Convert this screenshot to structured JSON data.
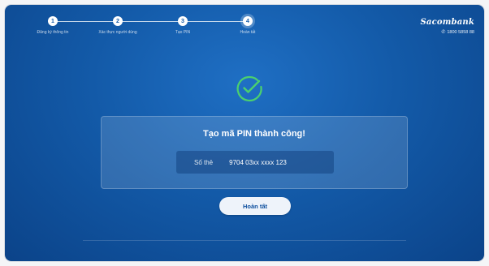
{
  "stepper": {
    "steps": [
      {
        "number": "1",
        "label": "Đăng ký thông tin"
      },
      {
        "number": "2",
        "label": "Xác thực người dùng"
      },
      {
        "number": "3",
        "label": "Tạo PIN"
      },
      {
        "number": "4",
        "label": "Hoàn tất"
      }
    ]
  },
  "brand": {
    "name": "Sacombank",
    "hotline": "1800 5858 88"
  },
  "result": {
    "title": "Tạo mã PIN thành công!",
    "card_label": "Số thẻ",
    "card_number": "9704 03xx xxxx 123"
  },
  "actions": {
    "finish_label": "Hoàn tất"
  },
  "colors": {
    "background": "#135aa8",
    "success": "#4bd06e",
    "button_bg": "#eef3fa",
    "button_text": "#0d4f9e"
  },
  "icons": {
    "success": "check-circle-icon",
    "hotline": "phone-icon"
  }
}
